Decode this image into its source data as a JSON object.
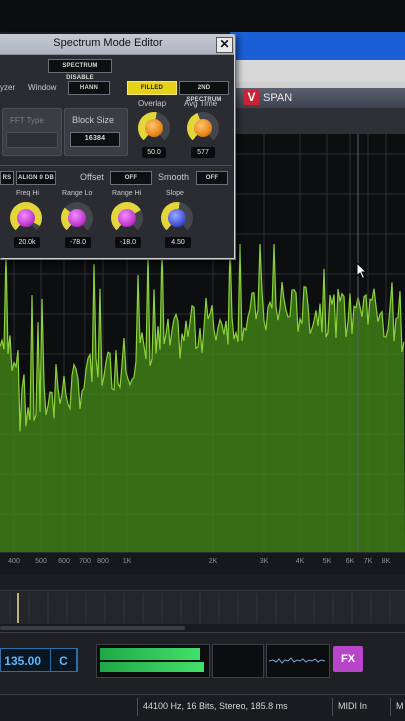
{
  "span_window": {
    "title": "SPAN",
    "logo": "V"
  },
  "spectrum": {
    "freq_ticks": [
      "400",
      "500",
      "600",
      "700",
      "800",
      "1K",
      "2K",
      "3K",
      "4K",
      "5K",
      "6K",
      "7K",
      "8K"
    ],
    "colors": {
      "fill": "#3f7f16",
      "line": "#8ed13a",
      "grid": "#2a2d33"
    }
  },
  "transport": {
    "bpm": "135.00",
    "key": "C",
    "fx": "FX"
  },
  "statusbar": {
    "info": "44100 Hz, 16 Bits, Stereo, 185.8 ms",
    "midi_in": "MIDI In",
    "midi_out": "M"
  },
  "editor": {
    "title": "Spectrum Mode Editor",
    "close": "✕",
    "spectrum_disable": "SPECTRUM DISABLE",
    "analyzer_label": "yzer",
    "window_label": "Window",
    "window_value": "HANN",
    "filled_display": "FILLED DISPLAY",
    "second_spectrum": "2ND SPECTRUM",
    "fft_type": "FFT Type",
    "block_size_label": "Block Size",
    "block_size_value": "16384",
    "overlap_label": "Overlap",
    "overlap_value": "50.0",
    "avg_time_label": "Avg Time",
    "avg_time_value": "577",
    "rs_button": "RS",
    "align_button": "ALIGN 0 DB",
    "offset_label": "Offset",
    "offset_value": "OFF",
    "smooth_label": "Smooth",
    "smooth_value": "OFF",
    "freq_hi_label": "Freq Hi",
    "freq_hi_value": "20.0k",
    "range_lo_label": "Range Lo",
    "range_lo_value": "-78.0",
    "range_hi_label": "Range Hi",
    "range_hi_value": "-18.0",
    "slope_label": "Slope",
    "slope_value": "4.50",
    "colors": {
      "accent_button": "#e6d21a",
      "knob_orange": "#e8891c",
      "knob_magenta": "#c23bd1",
      "knob_blue": "#4456d8"
    }
  }
}
